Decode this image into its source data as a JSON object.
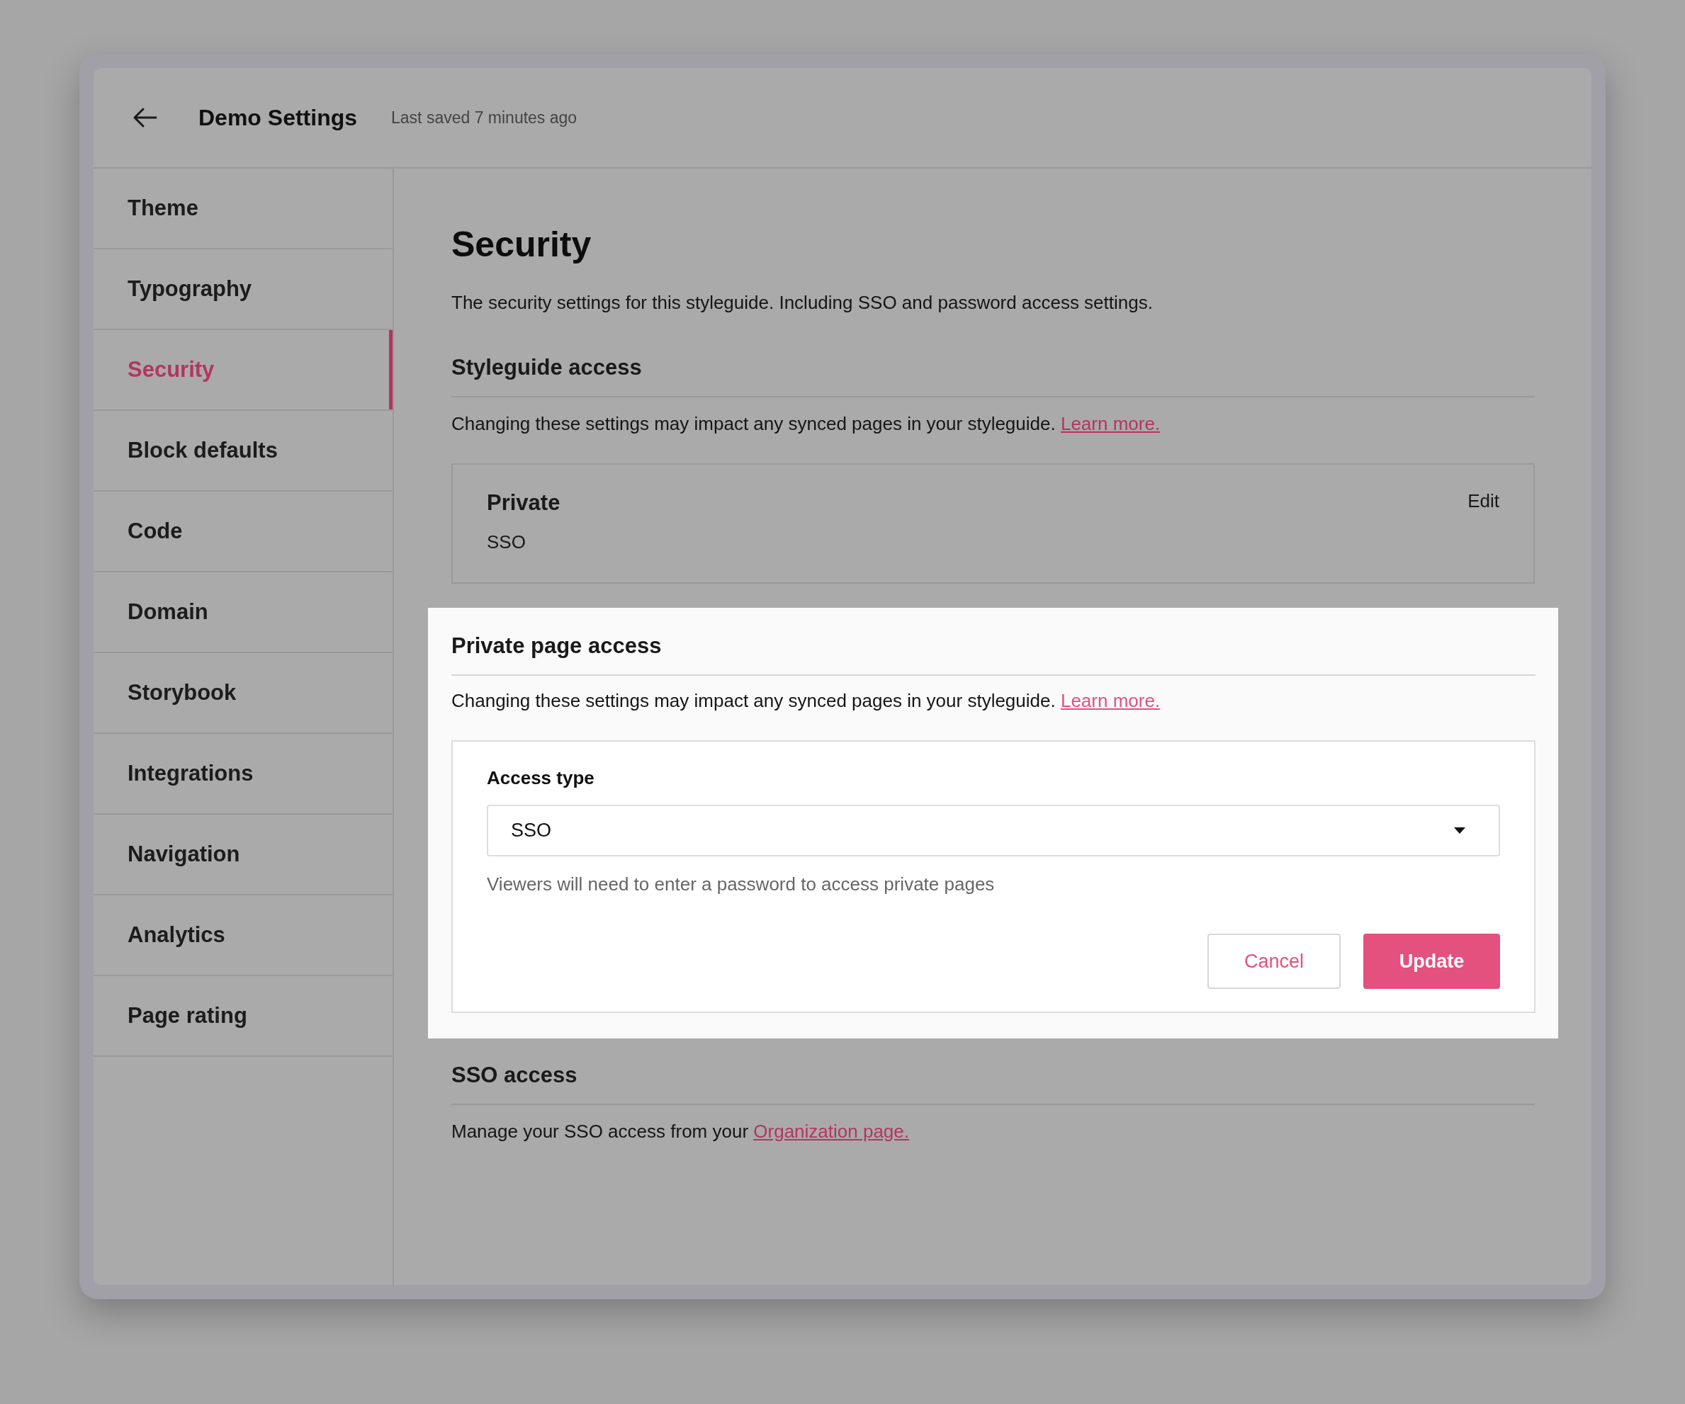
{
  "header": {
    "title": "Demo Settings",
    "last_saved": "Last saved 7 minutes ago"
  },
  "sidebar": {
    "items": [
      {
        "label": "Theme",
        "selected": false
      },
      {
        "label": "Typography",
        "selected": false
      },
      {
        "label": "Security",
        "selected": true
      },
      {
        "label": "Block defaults",
        "selected": false
      },
      {
        "label": "Code",
        "selected": false
      },
      {
        "label": "Domain",
        "selected": false
      },
      {
        "label": "Storybook",
        "selected": false
      },
      {
        "label": "Integrations",
        "selected": false
      },
      {
        "label": "Navigation",
        "selected": false
      },
      {
        "label": "Analytics",
        "selected": false
      },
      {
        "label": "Page rating",
        "selected": false
      }
    ]
  },
  "page": {
    "title": "Security",
    "description": "The security settings for this styleguide. Including SSO and password access settings."
  },
  "styleguide_access": {
    "heading": "Styleguide access",
    "note": "Changing these settings may impact any synced pages in your styleguide.",
    "link": "Learn more.",
    "card": {
      "title": "Private",
      "value": "SSO",
      "edit": "Edit"
    }
  },
  "private_page_access": {
    "heading": "Private page access",
    "note": "Changing these settings may impact any synced pages in your styleguide.",
    "link": "Learn more.",
    "field": {
      "label": "Access type",
      "value": "SSO",
      "hint": "Viewers will need to enter a password to access private pages"
    },
    "buttons": {
      "cancel": "Cancel",
      "update": "Update"
    }
  },
  "sso_access": {
    "heading": "SSO access",
    "note": "Manage your SSO access from your",
    "link": "Organization page."
  }
}
